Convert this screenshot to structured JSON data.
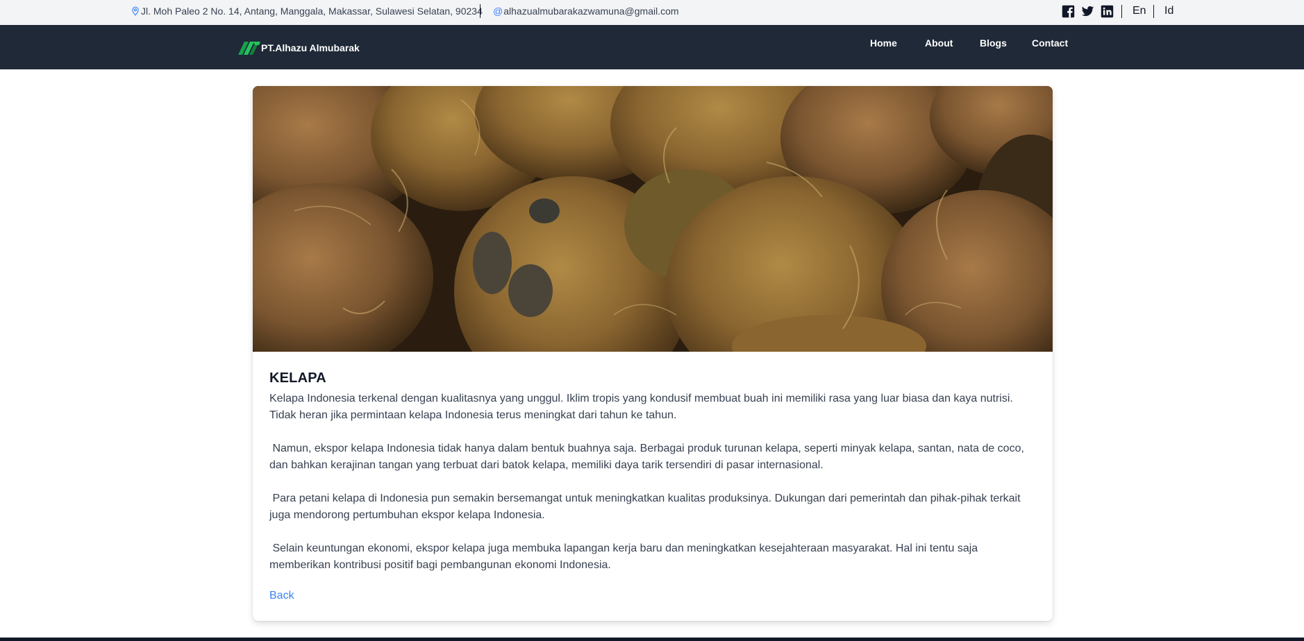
{
  "topbar": {
    "address": "Jl. Moh Paleo 2 No. 14, Antang, Manggala, Makassar, Sulawesi Selatan, 90234",
    "email": "alhazualmubarakazwamuna@gmail.com",
    "icons": [
      "map-pin-icon",
      "at-icon",
      "facebook-icon",
      "twitter-icon",
      "linkedin-icon"
    ],
    "languages": [
      "En",
      "Id"
    ]
  },
  "navbar": {
    "brand": "PT.Alhazu Almubarak",
    "links": [
      "Home",
      "About",
      "Blogs",
      "Contact"
    ]
  },
  "article": {
    "title": "KELAPA",
    "paragraphs": [
      "Kelapa Indonesia terkenal dengan kualitasnya yang unggul. Iklim tropis yang kondusif membuat buah ini memiliki rasa yang luar biasa dan kaya nutrisi. Tidak heran jika permintaan kelapa Indonesia terus meningkat dari tahun ke tahun.",
      " Namun, ekspor kelapa Indonesia tidak hanya dalam bentuk buahnya saja. Berbagai produk turunan kelapa, seperti minyak kelapa, santan, nata de coco, dan bahkan kerajinan tangan yang terbuat dari batok kelapa, memiliki daya tarik tersendiri di pasar internasional.",
      " Para petani kelapa di Indonesia pun semakin bersemangat untuk meningkatkan kualitas produksinya. Dukungan dari pemerintah dan pihak-pihak terkait juga mendorong pertumbuhan ekspor kelapa Indonesia.",
      " Selain keuntungan ekonomi, ekspor kelapa juga membuka lapangan kerja baru dan meningkatkan kesejahteraan masyarakat. Hal ini tentu saja memberikan kontribusi positif bagi pembangunan ekonomi Indonesia."
    ],
    "back_label": "Back"
  },
  "colors": {
    "navbar_bg": "#1f2937",
    "topbar_bg": "#f3f4f6",
    "brand_green": "#22c55e",
    "link_blue": "#3b82f6"
  }
}
